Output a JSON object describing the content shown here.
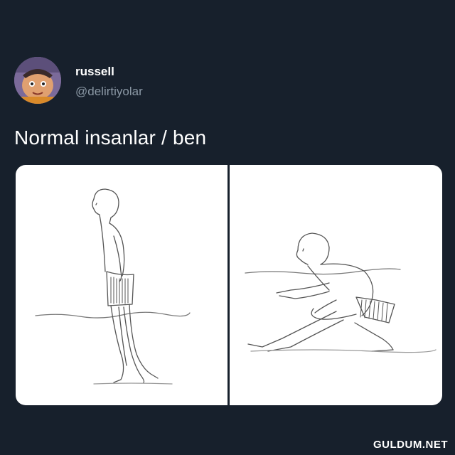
{
  "tweet": {
    "display_name": "russell",
    "handle": "@delirtiyolar",
    "text": "Normal insanlar / ben"
  },
  "media": {
    "panels": [
      {
        "name": "left-panel-walking-in-water"
      },
      {
        "name": "right-panel-crouching-in-water"
      }
    ]
  },
  "watermark": "GULDUM.NET",
  "colors": {
    "background": "#17202c",
    "text": "#ffffff",
    "handle": "#8b98a5"
  }
}
